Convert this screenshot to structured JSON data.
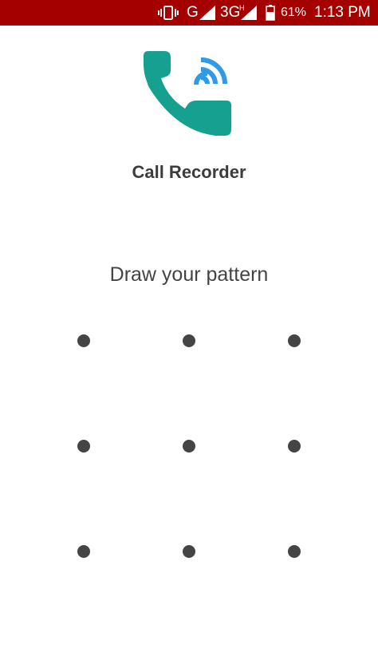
{
  "status_bar": {
    "network_g": "G",
    "network_3g": "3G",
    "network_h": "H",
    "battery_percent": "61%",
    "time": "1:13 PM",
    "background_color": "#a40000",
    "icons": [
      "vibrate-icon",
      "signal-icon",
      "battery-icon"
    ]
  },
  "app": {
    "title": "Call Recorder",
    "icon_name": "phone-call-recording-icon",
    "icon_colors": {
      "handset": "#16a08f",
      "waves": "#2f9be8"
    }
  },
  "lock": {
    "prompt": "Draw your pattern",
    "rows": 3,
    "cols": 3
  }
}
